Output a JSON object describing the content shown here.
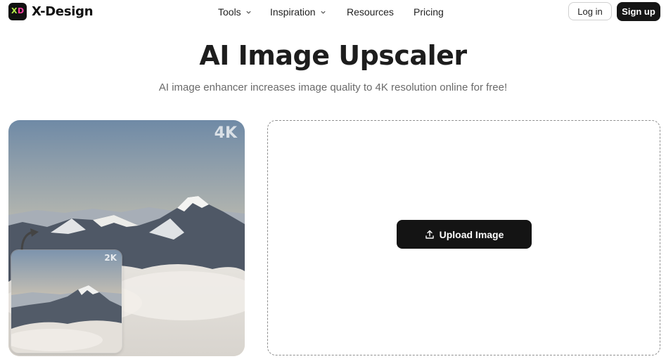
{
  "brand": {
    "name": "X-Design",
    "logo_letters": {
      "x": "X",
      "d": "D"
    },
    "logo_colors": {
      "x": "#b6f04a",
      "d": "#ff3fa4"
    }
  },
  "nav": {
    "items": [
      {
        "label": "Tools",
        "has_dropdown": true
      },
      {
        "label": "Inspiration",
        "has_dropdown": true
      },
      {
        "label": "Resources",
        "has_dropdown": false
      },
      {
        "label": "Pricing",
        "has_dropdown": false
      }
    ]
  },
  "auth": {
    "login_label": "Log in",
    "signup_label": "Sign up"
  },
  "hero": {
    "title": "AI Image Upscaler",
    "subtitle": "AI image enhancer increases image quality to 4K resolution online for free!"
  },
  "preview": {
    "large_badge": "4K",
    "small_badge": "2K"
  },
  "upload": {
    "button_label": "Upload Image",
    "icon": "upload-icon"
  },
  "colors": {
    "dark_button": "#141414",
    "accent_text": "#1d1d1d"
  }
}
